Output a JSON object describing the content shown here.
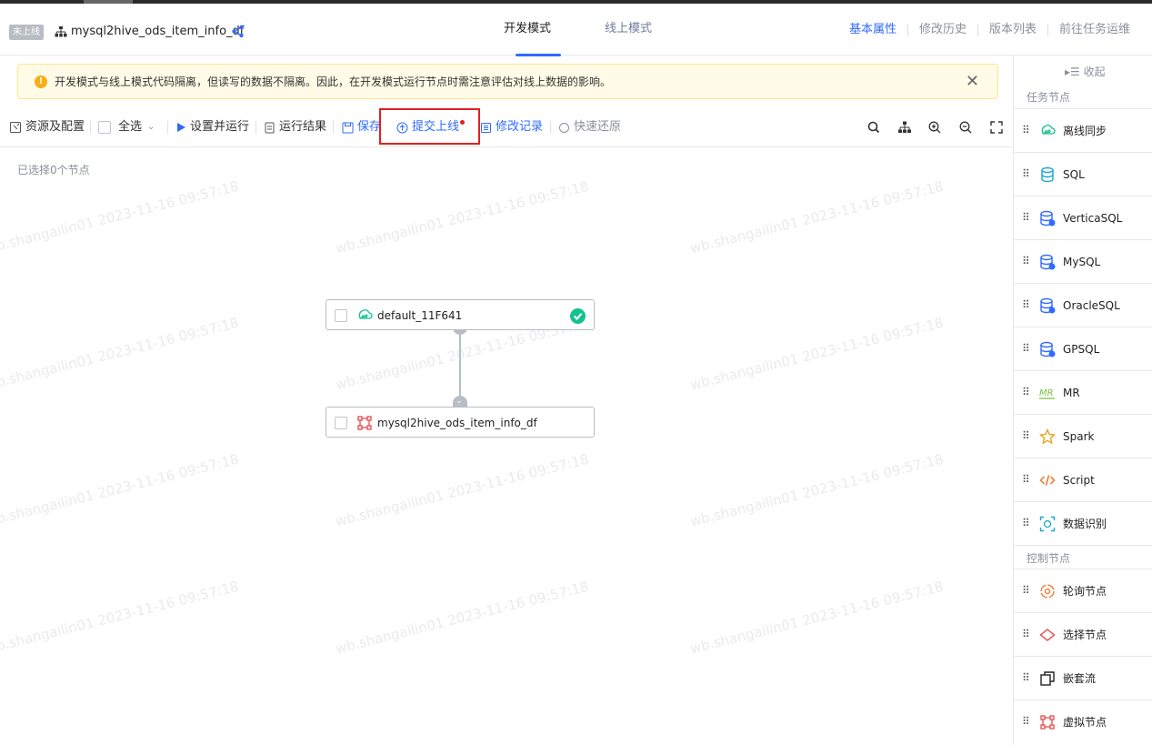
{
  "header": {
    "status_badge": "未上线",
    "task_name": "mysql2hive_ods_item_info_df",
    "mode_tabs": [
      "开发模式",
      "线上模式"
    ],
    "right_links": [
      "基本属性",
      "修改历史",
      "版本列表",
      "前往任务运维"
    ]
  },
  "alert": {
    "text": "开发模式与线上模式代码隔离，但读写的数据不隔离。因此，在开发模式运行节点时需注意评估对线上数据的影响。"
  },
  "toolbar": {
    "resources": "资源及配置",
    "select_all": "全选",
    "set_and_run": "设置并运行",
    "run_result": "运行结果",
    "save": "保存",
    "submit": "提交上线",
    "history": "修改记录",
    "restore": "快速还原"
  },
  "canvas": {
    "selected_count": "已选择0个节点",
    "watermark": "wb.shangailin01 2023-11-16 09:57:18",
    "nodes": [
      {
        "label": "default_11F641"
      },
      {
        "label": "mysql2hive_ods_item_info_df"
      }
    ]
  },
  "sidebar": {
    "collapse": "收起",
    "task_section": "任务节点",
    "task_items": [
      "离线同步",
      "SQL",
      "VerticaSQL",
      "MySQL",
      "OracleSQL",
      "GPSQL",
      "MR",
      "Spark",
      "Script",
      "数据识别"
    ],
    "control_section": "控制节点",
    "control_items": [
      "轮询节点",
      "选择节点",
      "嵌套流",
      "虚拟节点"
    ]
  },
  "colors": {
    "accent": "#2f6bff",
    "success": "#14c28f",
    "warning": "#faad14",
    "highlight": "#e02020"
  }
}
